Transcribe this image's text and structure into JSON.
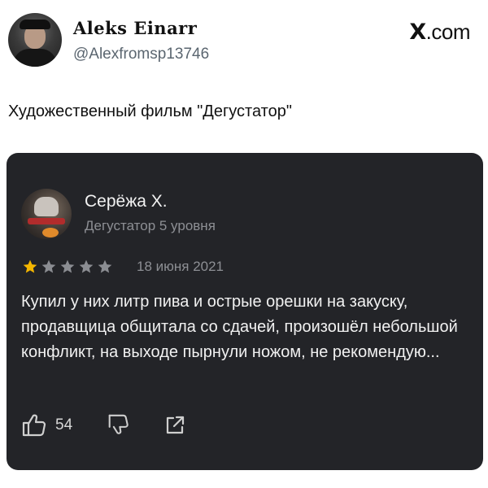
{
  "tweet": {
    "author_name": "Aleks Einarr",
    "author_handle": "@Alexfromsp13746",
    "brand": "X.com",
    "brand_x": "X",
    "brand_suffix": ".com",
    "text": "Художественный фильм \"Дегустатор\""
  },
  "review": {
    "reviewer_name": "Серёжа Х.",
    "reviewer_level": "Дегустатор 5 уровня",
    "rating": 1,
    "rating_max": 5,
    "date": "18 июня 2021",
    "text": "Купил у них литр пива и острые орешки на закуску, продавщица общитала со сдачей, произошёл небольшой конфликт, на выходе пырнули ножом, не рекомендую...",
    "likes": "54"
  },
  "colors": {
    "card_bg": "#232428",
    "star_filled": "#f5b700",
    "star_empty": "#8b8d92",
    "icon_stroke": "#cfcfcf"
  },
  "icons": {
    "like": "thumbs-up-icon",
    "dislike": "thumbs-down-icon",
    "share": "share-icon"
  }
}
